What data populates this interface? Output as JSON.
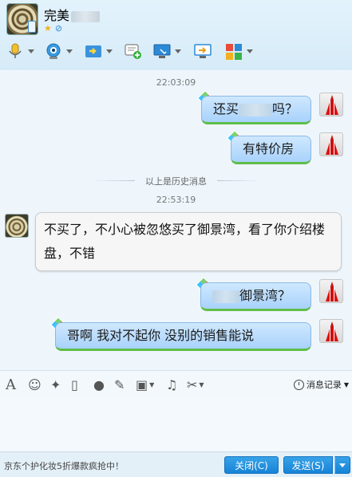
{
  "contact": {
    "name": "完美"
  },
  "toolbar": {
    "icons": [
      "microphone-icon",
      "video-camera-icon",
      "file-transfer-icon",
      "message-add-icon",
      "screen-capture-icon",
      "screen-share-icon",
      "apps-icon"
    ]
  },
  "chat": {
    "messages": [
      {
        "time": "22:03:09"
      },
      {
        "side": "out",
        "text_before": "还买",
        "text_after": "吗？"
      },
      {
        "side": "out",
        "text": "有特价房"
      },
      {
        "history_divider": "以上是历史消息"
      },
      {
        "time": "22:53:19"
      },
      {
        "side": "in",
        "text": "不买了，不小心被忽悠买了御景湾，看了你介绍楼盘，不错"
      },
      {
        "side": "out",
        "text_after": "御景湾？"
      },
      {
        "side": "out",
        "text": "哥啊 我对不起你  没别的销售能说"
      }
    ]
  },
  "input_toolbar": {
    "history_label": "消息记录"
  },
  "footer": {
    "ad_text": "京东个护化妆5折爆款疯抢中！",
    "close_label": "关闭(C)",
    "send_label": "发送(S)"
  },
  "colors": {
    "accent": "#1783d6",
    "bubble_out": "#a8d2fb",
    "bubble_underline": "#5fbd49"
  }
}
